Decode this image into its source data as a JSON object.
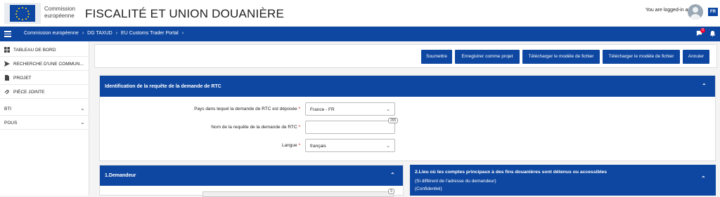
{
  "header": {
    "logo_line1": "Commission",
    "logo_line2": "européenne",
    "app_title": "FISCALITÉ ET UNION DOUANIÈRE",
    "login_text": "You are logged-in as",
    "language": "FR"
  },
  "navbar": {
    "breadcrumbs": [
      "Commission européenne",
      "DG TAXUD",
      "EU Customs Trader Portal"
    ],
    "notification_count": "0"
  },
  "sidebar": {
    "items": [
      {
        "label": "TABLEAU DE BORD",
        "icon": "dashboard-icon"
      },
      {
        "label": "RECHERCHE D'UNE COMMUN...",
        "icon": "send-icon"
      },
      {
        "label": "PROJET",
        "icon": "document-icon"
      },
      {
        "label": "PIÈCE JOINTE",
        "icon": "attachment-icon"
      },
      {
        "label": "BTI",
        "icon": "chevron-down-icon"
      },
      {
        "label": "POUS",
        "icon": "chevron-down-icon"
      }
    ]
  },
  "actions": {
    "submit": "Soumettre",
    "save_draft": "Enregistrer comme projet",
    "download_template_1": "Télécharger le modèle de fichier",
    "download_template_2": "Télécharger le modèle de fichier",
    "cancel": "Annuler"
  },
  "identification": {
    "title": "Identification de la requête de la demande de RTC",
    "country_label": "Pays dans lequel la demande de RTC est déposée",
    "country_value": "France - FR",
    "name_label": "Nom de la requête de la demande de RTC",
    "name_value": "",
    "name_counter": "265",
    "language_label": "Langue",
    "language_value": "français",
    "required_mark": "*"
  },
  "applicant": {
    "title": "1.Demandeur",
    "counter": "3"
  },
  "accounts": {
    "title": "2.Lieu où les comptes principaux à des fins douanières sont détenus ou accessibles",
    "subtitle": "(Si différent de l'adresse du demandeur)",
    "confidential": "(Confidentiel)"
  },
  "colors": {
    "primary": "#0e47a1",
    "required": "#d00000"
  }
}
